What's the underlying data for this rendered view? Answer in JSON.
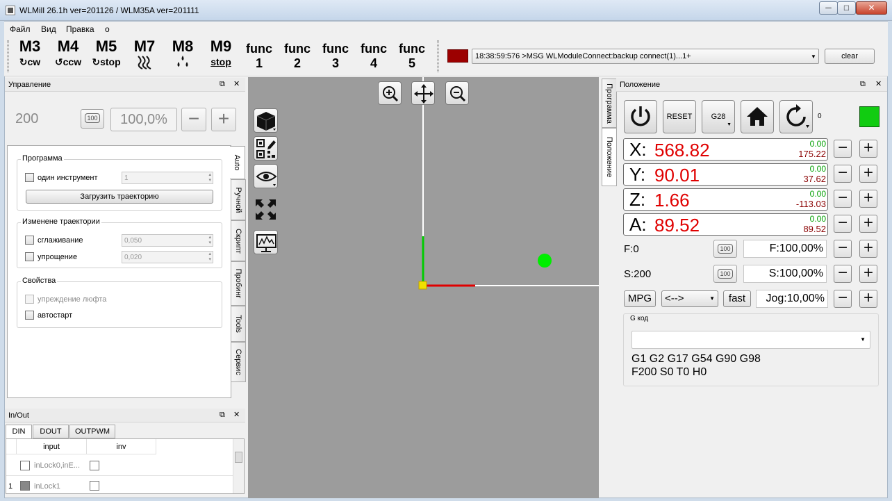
{
  "window": {
    "title": "WLMill 26.1h ver=201126 / WLM35A ver=201111",
    "min": "─",
    "max": "□",
    "close": "✕"
  },
  "menu": [
    "Файл",
    "Вид",
    "Правка",
    "o"
  ],
  "toolbar": {
    "mcodes": [
      {
        "code": "M3",
        "sub": "cw",
        "icon": "rotate-cw-icon"
      },
      {
        "code": "M4",
        "sub": "ccw",
        "icon": "rotate-ccw-icon"
      },
      {
        "code": "M5",
        "sub": "stop",
        "icon": "spindle-stop-icon"
      },
      {
        "code": "M7",
        "sub": "",
        "icon": "mist-coolant-icon"
      },
      {
        "code": "M8",
        "sub": "",
        "icon": "flood-coolant-icon"
      },
      {
        "code": "M9",
        "sub": "stop",
        "icon": "coolant-stop-icon"
      }
    ],
    "funcs": [
      {
        "label": "func",
        "num": "1"
      },
      {
        "label": "func",
        "num": "2"
      },
      {
        "label": "func",
        "num": "3"
      },
      {
        "label": "func",
        "num": "4"
      },
      {
        "label": "func",
        "num": "5"
      }
    ],
    "status_color": "#9c0000",
    "log_message": "18:38:59:576 >MSG WLModuleConnect:backup connect(1)...1+",
    "clear_label": "clear"
  },
  "control": {
    "title": "Управление",
    "value": "200",
    "btn100": "100",
    "percent": "100,0%",
    "minus": "−",
    "plus": "+",
    "program_group": "Программа",
    "one_tool_label": "один инструмент",
    "one_tool_value": "1",
    "load_label": "Загрузить траекторию",
    "traj_group": "Изменене траектории",
    "smoothing_label": "сглаживание",
    "smoothing_value": "0,050",
    "simplify_label": "упрощение",
    "simplify_value": "0,020",
    "props_group": "Свойства",
    "backlash_label": "упреждение люфта",
    "autostart_label": "автостарт",
    "tabs": [
      "Auto",
      "Ручной",
      "Скрипт",
      "Пробинг",
      "Tools",
      "Сервис"
    ]
  },
  "io": {
    "title": "In/Out",
    "tabs": [
      "DIN",
      "DOUT",
      "OUTPWM"
    ],
    "columns": [
      "input",
      "inv"
    ],
    "rows": [
      {
        "index": "",
        "name": "inLock0,inE..."
      },
      {
        "index": "1",
        "name": "inLock1"
      }
    ]
  },
  "position": {
    "title": "Положение",
    "side_tabs": [
      "Программа",
      "Положение"
    ],
    "reset_label": "RESET",
    "g28_label": "G28",
    "counter": "0",
    "status_color": "#11cc11",
    "axes": [
      {
        "letter": "X:",
        "value": "568.82",
        "small1": "0.00",
        "small2": "175.22"
      },
      {
        "letter": "Y:",
        "value": "90.01",
        "small1": "0.00",
        "small2": "37.62"
      },
      {
        "letter": "Z:",
        "value": "1.66",
        "small1": "0.00",
        "small2": "-113.03"
      },
      {
        "letter": "A:",
        "value": "89.52",
        "small1": "0.00",
        "small2": "89.52"
      }
    ],
    "f_label": "F:0",
    "f_value": "F:100,00%",
    "s_label": "S:200",
    "s_value": "S:100,00%",
    "mpg_label": "MPG",
    "mode_label": "<-->",
    "fast_label": "fast",
    "jog_label": "Jog:10,00%",
    "gcode_group": "G код",
    "gcode_line1": "G1 G2 G17 G54 G90 G98",
    "gcode_line2": "F200 S0 T0 H0"
  }
}
